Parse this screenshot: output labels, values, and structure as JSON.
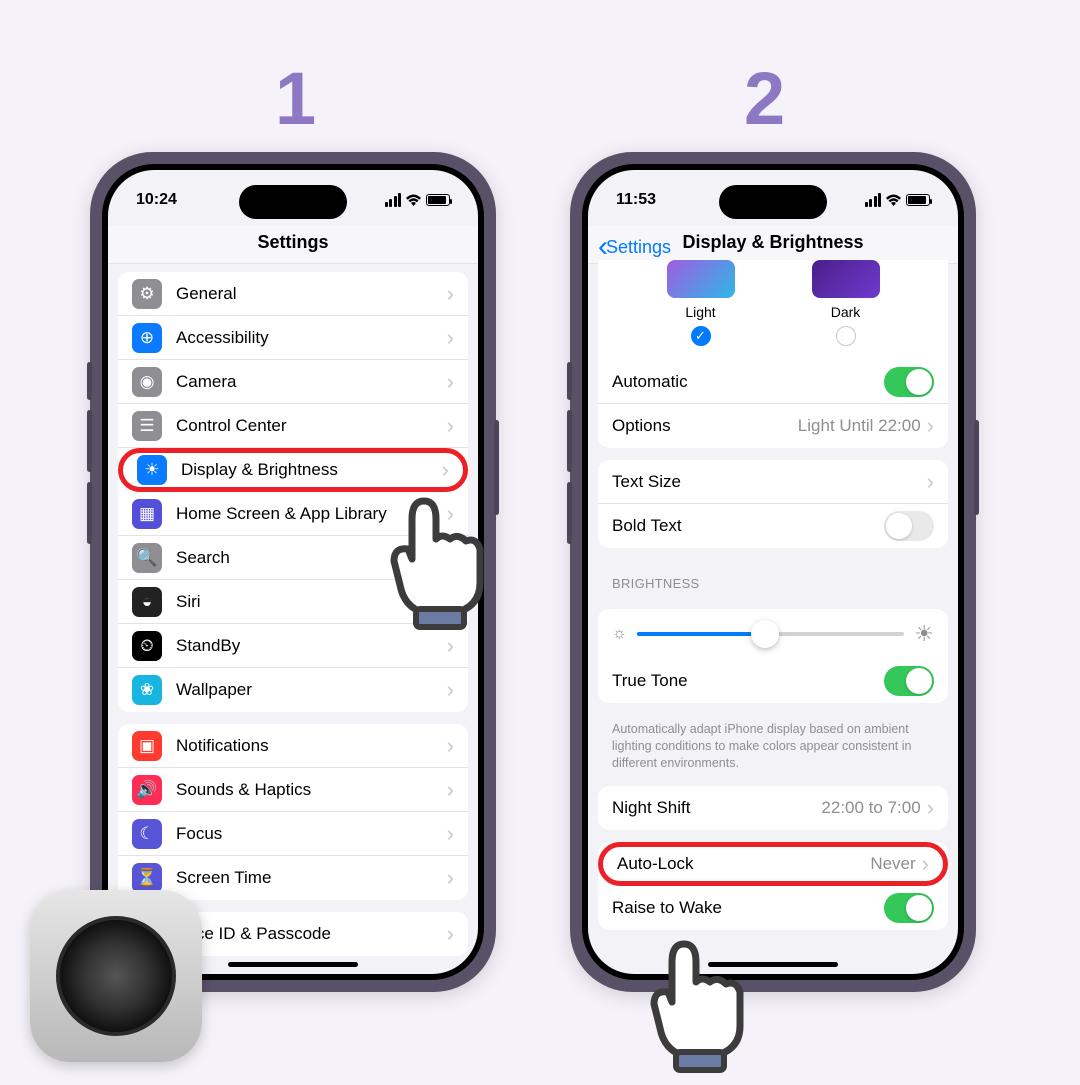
{
  "steps": {
    "one": "1",
    "two": "2"
  },
  "phone1": {
    "time": "10:24",
    "title": "Settings",
    "rows": [
      {
        "label": "General",
        "icon": "#8e8e93",
        "glyph": "⚙"
      },
      {
        "label": "Accessibility",
        "icon": "#0a7aff",
        "glyph": "⊕"
      },
      {
        "label": "Camera",
        "icon": "#8e8e93",
        "glyph": "◉"
      },
      {
        "label": "Control Center",
        "icon": "#8e8e93",
        "glyph": "☰"
      },
      {
        "label": "Display & Brightness",
        "icon": "#0a7aff",
        "glyph": "☀",
        "hl": true
      },
      {
        "label": "Home Screen & App Library",
        "icon": "#534fd8",
        "glyph": "▦"
      },
      {
        "label": "Search",
        "icon": "#8e8e93",
        "glyph": "🔍"
      },
      {
        "label": "Siri",
        "icon": "#222",
        "glyph": "◒"
      },
      {
        "label": "StandBy",
        "icon": "#000",
        "glyph": "⏲"
      },
      {
        "label": "Wallpaper",
        "icon": "#18b5e0",
        "glyph": "❀"
      }
    ],
    "rows2": [
      {
        "label": "Notifications",
        "icon": "#ff3b30",
        "glyph": "▣"
      },
      {
        "label": "Sounds & Haptics",
        "icon": "#ff2d55",
        "glyph": "🔊"
      },
      {
        "label": "Focus",
        "icon": "#5856d6",
        "glyph": "☾"
      },
      {
        "label": "Screen Time",
        "icon": "#5856d6",
        "glyph": "⏳"
      }
    ],
    "rows3": [
      {
        "label": "Face ID & Passcode",
        "icon": "#34c759",
        "glyph": "☻"
      }
    ]
  },
  "phone2": {
    "time": "11:53",
    "back": "Settings",
    "title": "Display & Brightness",
    "light": "Light",
    "dark": "Dark",
    "automatic": "Automatic",
    "options": "Options",
    "options_val": "Light Until 22:00",
    "textsize": "Text Size",
    "bold": "Bold Text",
    "section_brightness": "BRIGHTNESS",
    "truetone": "True Tone",
    "truetone_note": "Automatically adapt iPhone display based on ambient lighting conditions to make colors appear consistent in different environments.",
    "nightshift": "Night Shift",
    "nightshift_val": "22:00 to 7:00",
    "autolock": "Auto-Lock",
    "autolock_val": "Never",
    "raise": "Raise to Wake"
  }
}
